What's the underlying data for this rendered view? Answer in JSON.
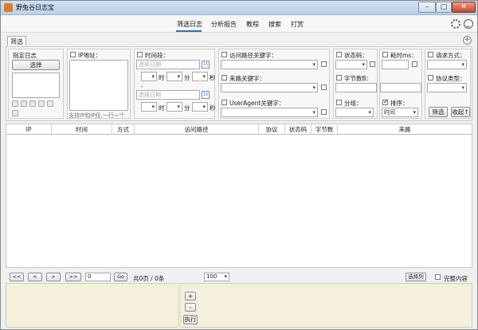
{
  "window": {
    "title": "野兔谷日志宝",
    "min": "–",
    "max": "□",
    "close": "✕"
  },
  "nav": {
    "items": [
      "筛选日志",
      "分析报告",
      "教程",
      "搜索",
      "打赏"
    ],
    "active": "筛选日志"
  },
  "tab": {
    "label": "筛选"
  },
  "filter": {
    "log": {
      "title": "指定日志",
      "select_button": "选择"
    },
    "ip": {
      "label": "IP地址：",
      "hint": "支持IP和IP段,一行一个"
    },
    "time": {
      "label": "时间段：",
      "start_placeholder": "选择日期",
      "end_placeholder": "选择日期",
      "hour": "时",
      "minute": "分",
      "second": "秒",
      "dash": "-"
    },
    "path": {
      "label": "访问路径关键字："
    },
    "referer": {
      "label": "来路关键字："
    },
    "ua": {
      "label": "UserAgent关键字："
    },
    "status": {
      "label": "状态码："
    },
    "bytes": {
      "label": "字节数B："
    },
    "group": {
      "label": "分组："
    },
    "duration": {
      "label": "耗时ms："
    },
    "sort": {
      "label": "排序：",
      "value": "时间"
    },
    "method": {
      "label": "请求方式："
    },
    "protocol": {
      "label": "协议类型："
    },
    "filter_button": "筛选",
    "collapse_button": "收起↑"
  },
  "table": {
    "columns": [
      "IP",
      "时间",
      "方式",
      "访问路径",
      "协议",
      "状态码",
      "字节数",
      "来路"
    ]
  },
  "pager": {
    "first": "<<",
    "prev": "<",
    "next": ">",
    "last": ">>",
    "page_input": "0",
    "go": "Go",
    "info": "共0页 / 0条",
    "page_size": "100",
    "select_columns": "选择列",
    "full_content": "完整内容"
  },
  "bottom": {
    "plus": "+",
    "minus": "-",
    "execute": "执行"
  }
}
